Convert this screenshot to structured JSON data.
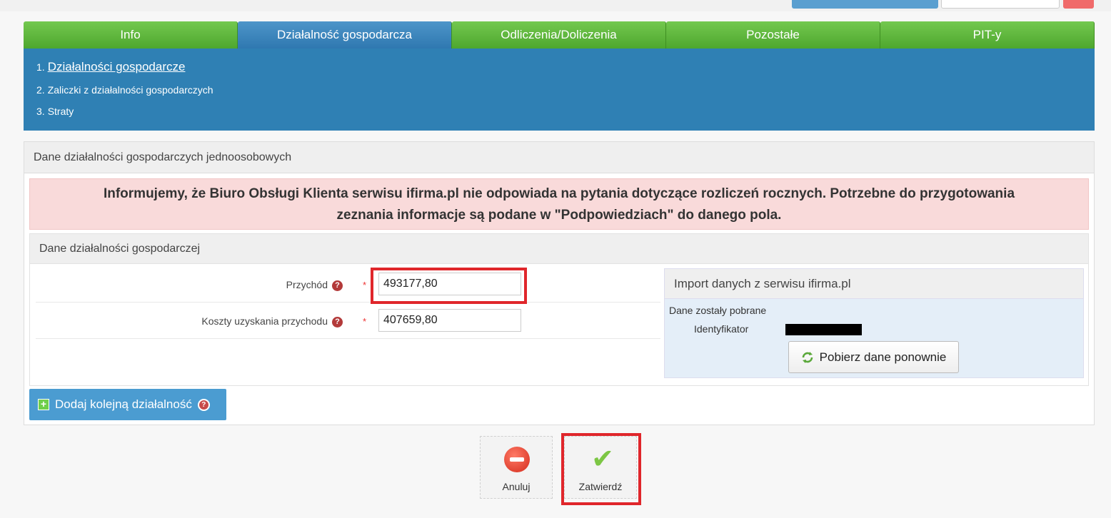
{
  "tabs": [
    {
      "label": "Info"
    },
    {
      "label": "Działalność gospodarcza"
    },
    {
      "label": "Odliczenia/Doliczenia"
    },
    {
      "label": "Pozostałe"
    },
    {
      "label": "PIT-y"
    }
  ],
  "active_tab": "Działalność gospodarcza",
  "subnav": [
    {
      "num": "1.",
      "label": "Działalności gospodarcze"
    },
    {
      "num": "2.",
      "label": "Zaliczki z działalności gospodarczych"
    },
    {
      "num": "3.",
      "label": "Straty"
    }
  ],
  "panel": {
    "title": "Dane działalności gospodarczych jednoosobowych",
    "alert_line1": "Informujemy, że Biuro Obsługi Klienta serwisu ifirma.pl nie odpowiada na pytania dotyczące rozliczeń rocznych. Potrzebne do przygotowania",
    "alert_line2": "zeznania informacje są podane w \"Podpowiedziach\" do danego pola."
  },
  "subpanel": {
    "title": "Dane działalności gospodarczej",
    "fields": {
      "revenue_label": "Przychód",
      "revenue_value": "493177,80",
      "costs_label": "Koszty uzyskania przychodu",
      "costs_value": "407659,80",
      "required_mark": "*",
      "help_glyph": "?"
    },
    "import": {
      "title": "Import danych z serwisu ifirma.pl",
      "status": "Dane zostały pobrane",
      "id_label": "Identyfikator",
      "refresh_label": "Pobierz dane ponownie"
    }
  },
  "add_button_label": "Dodaj kolejną działalność",
  "actions": {
    "cancel_label": "Anuluj",
    "confirm_label": "Zatwierdź"
  },
  "colors": {
    "tab_green": "#5cb83a",
    "tab_active_blue": "#3a87bd",
    "highlight_red": "#e0262b"
  }
}
